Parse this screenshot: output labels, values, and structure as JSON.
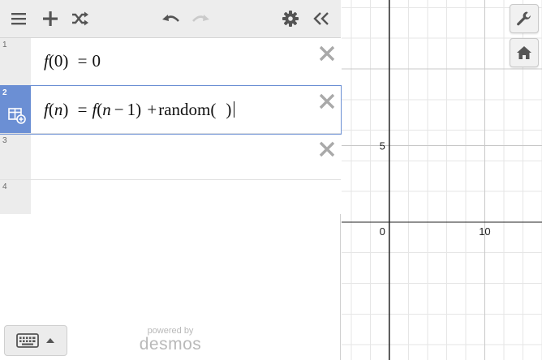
{
  "toolbar": {
    "menu_icon": "hamburger-icon",
    "add_icon": "plus-icon",
    "shuffle_icon": "shuffle-icon",
    "undo_icon": "undo-icon",
    "redo_icon": "redo-icon",
    "settings_icon": "gear-icon",
    "collapse_icon": "double-chevron-left-icon"
  },
  "expressions": [
    {
      "number": "1",
      "text": "f(0) = 0",
      "selected": false
    },
    {
      "number": "2",
      "text": "f(n) = f(n − 1) + random( )",
      "selected": true,
      "gutter_icon": "table-add-icon"
    },
    {
      "number": "3",
      "text": "",
      "selected": false
    },
    {
      "number": "4",
      "text": "",
      "selected": false
    }
  ],
  "math": {
    "f": "f",
    "n": "n",
    "zero": "0",
    "one": "1",
    "eq": "=",
    "minus": "−",
    "plus": "+",
    "lparen": "(",
    "rparen": ")",
    "random": "random"
  },
  "footer": {
    "keyboard_icon": "keyboard-icon",
    "caret_icon": "caret-up-icon",
    "powered_by": "powered by",
    "brand": "desmos"
  },
  "graph": {
    "x_range": [
      -5,
      16
    ],
    "y_range": [
      -9,
      14.5
    ],
    "grid_minor_step": 2,
    "grid_major_step": 10,
    "x_ticks": [
      {
        "value": 0,
        "label": "0"
      },
      {
        "value": 10,
        "label": "10"
      }
    ],
    "y_ticks": [
      {
        "value": 5,
        "label": "5"
      }
    ],
    "wrench_icon": "wrench-icon",
    "home_icon": "home-icon",
    "colors": {
      "minor_grid": "#e6e6e6",
      "major_grid": "#c8c8c8",
      "axis": "#222222"
    }
  }
}
